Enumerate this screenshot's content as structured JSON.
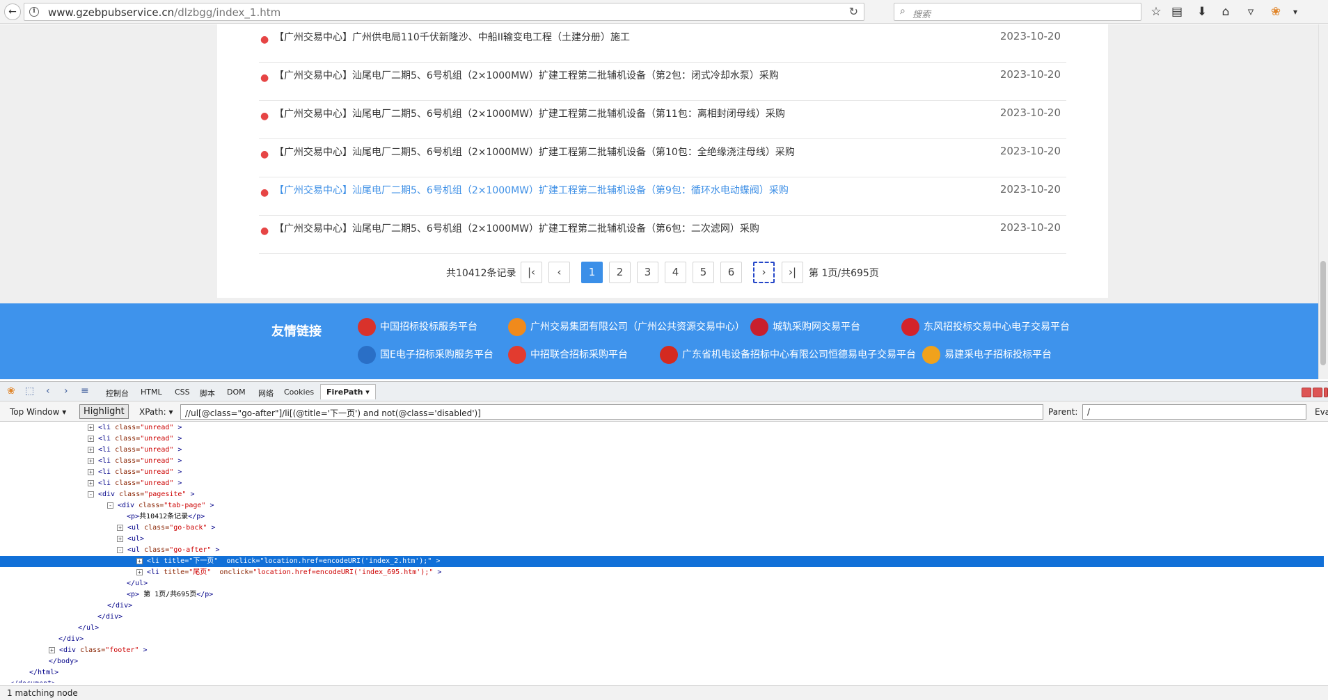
{
  "browser": {
    "url_host": "www.gzebpubservice.cn",
    "url_path": "/dlzbgg/index_1.htm",
    "search_placeholder": "搜索",
    "icons": [
      "back-arrow",
      "info",
      "reload",
      "search",
      "bookmark-star",
      "reading-list",
      "download",
      "home",
      "pocket",
      "firebug",
      "menu-chevron"
    ]
  },
  "news": {
    "items": [
      {
        "title": "【广州交易中心】广州供电局110千伏新隆沙、中船II输变电工程（土建分册）施工",
        "date": "2023-10-20"
      },
      {
        "title": "【广州交易中心】汕尾电厂二期5、6号机组（2×1000MW）扩建工程第二批辅机设备（第2包：闭式冷却水泵）采购",
        "date": "2023-10-20"
      },
      {
        "title": "【广州交易中心】汕尾电厂二期5、6号机组（2×1000MW）扩建工程第二批辅机设备（第11包：离相封闭母线）采购",
        "date": "2023-10-20"
      },
      {
        "title": "【广州交易中心】汕尾电厂二期5、6号机组（2×1000MW）扩建工程第二批辅机设备（第10包：全绝缘浇注母线）采购",
        "date": "2023-10-20"
      },
      {
        "title": "【广州交易中心】汕尾电厂二期5、6号机组（2×1000MW）扩建工程第二批辅机设备（第9包：循环水电动蝶阀）采购",
        "date": "2023-10-20"
      },
      {
        "title": "【广州交易中心】汕尾电厂二期5、6号机组（2×1000MW）扩建工程第二批辅机设备（第6包：二次滤网）采购",
        "date": "2023-10-20"
      }
    ]
  },
  "pager": {
    "total": "共10412条记录",
    "first": "K",
    "prev": "<",
    "pages": [
      "1",
      "2",
      "3",
      "4",
      "5",
      "6"
    ],
    "current": "1",
    "next": ">",
    "last": ">|",
    "pageinfo": "第 1页/共695页"
  },
  "friends": {
    "title": "友情链接",
    "links": [
      {
        "label": "中国招标投标服务平台",
        "color": "#d9322b"
      },
      {
        "label": "广州交易集团有限公司（广州公共资源交易中心）",
        "color": "#f08a1c"
      },
      {
        "label": "城轨采购网交易平台",
        "color": "#c81f2d"
      },
      {
        "label": "东风招投标交易中心电子交易平台",
        "color": "#d3232a"
      },
      {
        "label": "国E电子招标采购服务平台",
        "color": "#2a6fc6"
      },
      {
        "label": "中招联合招标采购平台",
        "color": "#e23b2f"
      },
      {
        "label": "广东省机电设备招标中心有限公司恒德易电子交易平台",
        "color": "#d42a20"
      },
      {
        "label": "易建采电子招标投标平台",
        "color": "#f0a21c"
      }
    ]
  },
  "devtools": {
    "tabs": [
      "控制台",
      "HTML",
      "CSS",
      "脚本",
      "DOM",
      "网络",
      "Cookies",
      "FirePath"
    ],
    "top_window": "Top Window",
    "highlight": "Highlight",
    "xpath_label": "XPath:",
    "xpath_value": "//ul[@class=\"go-after\"]/li[(@title='下一页') and not(@class='disabled')]",
    "parent_label": "Parent:",
    "parent_value": "/",
    "eval_label": "Eva",
    "status": "1 matching node",
    "tree": [
      {
        "indent": 9,
        "exp": "+",
        "parts": [
          [
            "tg",
            "<li "
          ],
          [
            "an",
            "class="
          ],
          [
            "av",
            "\"unread\""
          ],
          [
            "tg",
            ">"
          ]
        ]
      },
      {
        "indent": 9,
        "exp": "+",
        "parts": [
          [
            "tg",
            "<li "
          ],
          [
            "an",
            "class="
          ],
          [
            "av",
            "\"unread\""
          ],
          [
            "tg",
            ">"
          ]
        ]
      },
      {
        "indent": 9,
        "exp": "+",
        "parts": [
          [
            "tg",
            "<li "
          ],
          [
            "an",
            "class="
          ],
          [
            "av",
            "\"unread\""
          ],
          [
            "tg",
            ">"
          ]
        ]
      },
      {
        "indent": 9,
        "exp": "+",
        "parts": [
          [
            "tg",
            "<li "
          ],
          [
            "an",
            "class="
          ],
          [
            "av",
            "\"unread\""
          ],
          [
            "tg",
            ">"
          ]
        ]
      },
      {
        "indent": 9,
        "exp": "+",
        "parts": [
          [
            "tg",
            "<li "
          ],
          [
            "an",
            "class="
          ],
          [
            "av",
            "\"unread\""
          ],
          [
            "tg",
            ">"
          ]
        ]
      },
      {
        "indent": 9,
        "exp": "+",
        "parts": [
          [
            "tg",
            "<li "
          ],
          [
            "an",
            "class="
          ],
          [
            "av",
            "\"unread\""
          ],
          [
            "tg",
            ">"
          ]
        ]
      },
      {
        "indent": 9,
        "exp": "-",
        "parts": [
          [
            "tg",
            "<div "
          ],
          [
            "an",
            "class="
          ],
          [
            "av",
            "\"pagesite\""
          ],
          [
            "tg",
            ">"
          ]
        ]
      },
      {
        "indent": 11,
        "exp": "-",
        "parts": [
          [
            "tg",
            "<div "
          ],
          [
            "an",
            "class="
          ],
          [
            "av",
            "\"tab-page\""
          ],
          [
            "tg",
            ">"
          ]
        ]
      },
      {
        "indent": 13,
        "exp": "",
        "parts": [
          [
            "tg",
            "<p>"
          ],
          [
            "tx",
            "共10412条记录"
          ],
          [
            "tg",
            "</p>"
          ]
        ]
      },
      {
        "indent": 12,
        "exp": "+",
        "parts": [
          [
            "tg",
            "<ul "
          ],
          [
            "an",
            "class="
          ],
          [
            "av",
            "\"go-back\""
          ],
          [
            "tg",
            ">"
          ]
        ]
      },
      {
        "indent": 12,
        "exp": "+",
        "parts": [
          [
            "tg",
            "<ul>"
          ]
        ]
      },
      {
        "indent": 12,
        "exp": "-",
        "parts": [
          [
            "tg",
            "<ul "
          ],
          [
            "an",
            "class="
          ],
          [
            "av",
            "\"go-after\""
          ],
          [
            "tg",
            ">"
          ]
        ]
      },
      {
        "indent": 14,
        "exp": "+",
        "sel": true,
        "parts": [
          [
            "tg",
            "<li "
          ],
          [
            "an",
            "title="
          ],
          [
            "av",
            "\"下一页\" "
          ],
          [
            "an",
            "onclick="
          ],
          [
            "av",
            "\"location.href=encodeURI('index_2.htm');\""
          ],
          [
            "tg",
            ">"
          ]
        ]
      },
      {
        "indent": 14,
        "exp": "+",
        "parts": [
          [
            "tg",
            "<li "
          ],
          [
            "an",
            "title="
          ],
          [
            "av",
            "\"尾页\" "
          ],
          [
            "an",
            "onclick="
          ],
          [
            "av",
            "\"location.href=encodeURI('index_695.htm');\""
          ],
          [
            "tg",
            ">"
          ]
        ]
      },
      {
        "indent": 13,
        "exp": "",
        "parts": [
          [
            "tg",
            "</ul>"
          ]
        ]
      },
      {
        "indent": 13,
        "exp": "",
        "parts": [
          [
            "tg",
            "<p>"
          ],
          [
            "tx",
            " 第 1页/共695页"
          ],
          [
            "tg",
            "</p>"
          ]
        ]
      },
      {
        "indent": 11,
        "exp": "",
        "parts": [
          [
            "tg",
            "</div>"
          ]
        ]
      },
      {
        "indent": 10,
        "exp": "",
        "parts": [
          [
            "tg",
            "</div>"
          ]
        ]
      },
      {
        "indent": 8,
        "exp": "",
        "parts": [
          [
            "tg",
            "</ul>"
          ]
        ]
      },
      {
        "indent": 6,
        "exp": "",
        "parts": [
          [
            "tg",
            "</div>"
          ]
        ]
      },
      {
        "indent": 5,
        "exp": "+",
        "parts": [
          [
            "tg",
            "<div "
          ],
          [
            "an",
            "class="
          ],
          [
            "av",
            "\"footer\""
          ],
          [
            "tg",
            ">"
          ]
        ]
      },
      {
        "indent": 5,
        "exp": "",
        "parts": [
          [
            "tg",
            "</body>"
          ]
        ]
      },
      {
        "indent": 3,
        "exp": "",
        "parts": [
          [
            "tg",
            "</html>"
          ]
        ]
      },
      {
        "indent": 1,
        "exp": "",
        "parts": [
          [
            "tg",
            "</document>"
          ]
        ]
      }
    ]
  }
}
